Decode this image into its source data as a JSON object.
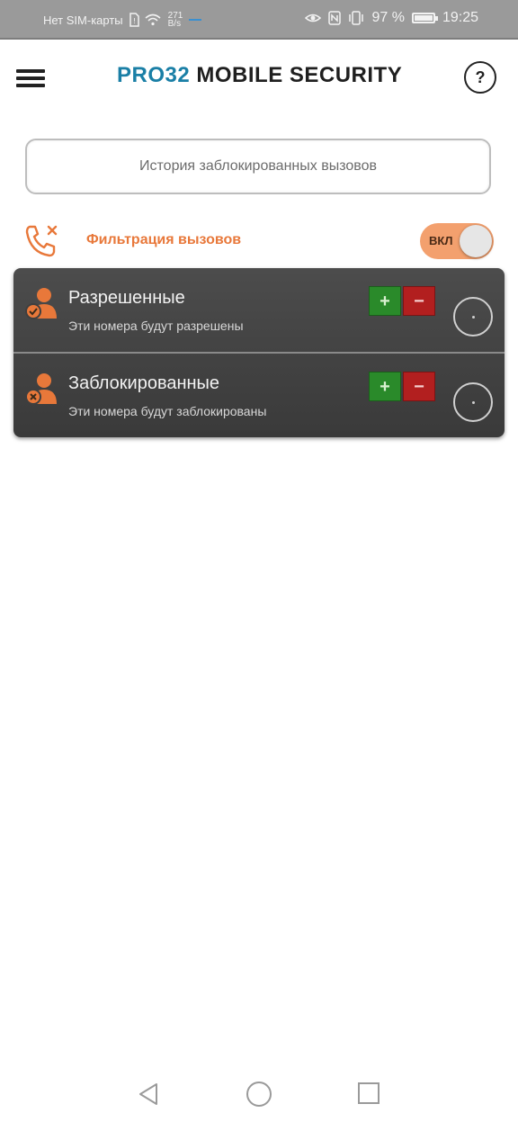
{
  "status_bar": {
    "sim_text": "Нет SIM-карты",
    "speed_value": "271",
    "speed_unit": "B/s",
    "battery_percent": "97 %",
    "time": "19:25"
  },
  "app_bar": {
    "logo_brand": "PRO32",
    "logo_rest": " MOBILE SECURITY",
    "help_symbol": "?"
  },
  "history_button": {
    "label": "История заблокированных вызовов"
  },
  "filter": {
    "label": "Фильтрация вызовов",
    "toggle_label": "ВКЛ",
    "enabled": true
  },
  "lists": [
    {
      "title": "Разрешенные",
      "subtitle": "Эти номера будут разрешены",
      "plus": "+",
      "minus": "−",
      "icon": "person-check-icon"
    },
    {
      "title": "Заблокированные",
      "subtitle": "Эти номера будут заблокированы",
      "plus": "+",
      "minus": "−",
      "icon": "person-blocked-icon"
    }
  ],
  "colors": {
    "accent_orange": "#e8783a",
    "brand_blue": "#1a7fa6",
    "add_green": "#2a8a2a",
    "remove_red": "#b21f1f",
    "panel_dark": "#444444"
  }
}
